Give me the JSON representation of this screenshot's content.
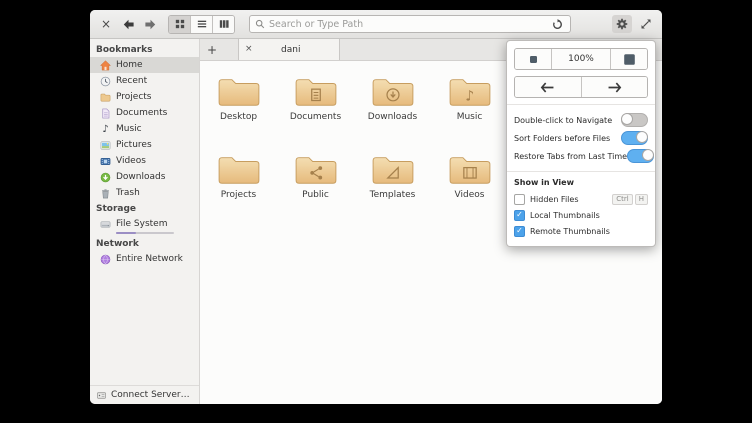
{
  "icons": {
    "close": "×",
    "plus": "+",
    "check": "✓",
    "music_note": "♪"
  },
  "toolbar": {
    "search_placeholder": "Search or Type Path"
  },
  "sidebar": {
    "sections": [
      {
        "title": "Bookmarks",
        "items": [
          {
            "label": "Home"
          },
          {
            "label": "Recent"
          },
          {
            "label": "Projects"
          },
          {
            "label": "Documents"
          },
          {
            "label": "Music"
          },
          {
            "label": "Pictures"
          },
          {
            "label": "Videos"
          },
          {
            "label": "Downloads"
          },
          {
            "label": "Trash"
          }
        ]
      },
      {
        "title": "Storage",
        "items": [
          {
            "label": "File System"
          }
        ]
      },
      {
        "title": "Network",
        "items": [
          {
            "label": "Entire Network"
          }
        ]
      }
    ],
    "connect_server": "Connect Server…"
  },
  "tabbar": {
    "active_tab": "dani"
  },
  "files": [
    {
      "label": "Desktop"
    },
    {
      "label": "Documents"
    },
    {
      "label": "Downloads"
    },
    {
      "label": "Music"
    },
    {
      "label": "Projects"
    },
    {
      "label": "Public"
    },
    {
      "label": "Templates"
    },
    {
      "label": "Videos"
    }
  ],
  "popover": {
    "zoom_value": "100%",
    "switches": [
      {
        "label": "Double-click to Navigate",
        "on": false
      },
      {
        "label": "Sort Folders before Files",
        "on": true
      },
      {
        "label": "Restore Tabs from Last Time",
        "on": true
      }
    ],
    "section_label": "Show in View",
    "checkboxes": [
      {
        "label": "Hidden Files",
        "checked": false
      },
      {
        "label": "Local Thumbnails",
        "checked": true
      },
      {
        "label": "Remote Thumbnails",
        "checked": true
      }
    ],
    "shortcut_keys": [
      "Ctrl",
      "H"
    ]
  },
  "colors": {
    "accent": "#5fb0f0",
    "folder_fill": "#ecc488",
    "window_bg": "#fbfbfa"
  }
}
